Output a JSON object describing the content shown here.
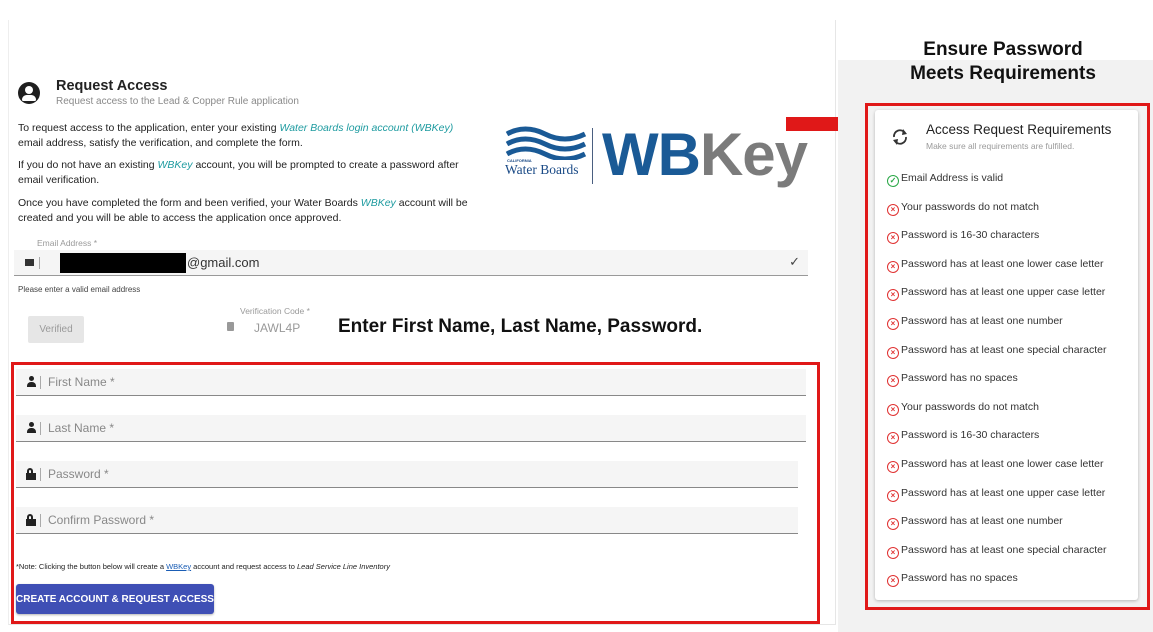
{
  "header": {
    "title": "Request Access",
    "subtitle": "Request access to the Lead & Copper Rule application"
  },
  "intro": {
    "p1_pre": "To request access to the application, enter your existing ",
    "p1_em": "Water Boards login account (WBKey)",
    "p1_post": " email address, satisfy the verification, and complete the form.",
    "p2_pre": "If you do not have an existing ",
    "p2_em": "WBKey",
    "p2_post": " account, you will be prompted to create a password after email verification.",
    "p3_pre": "Once you have completed the form and been verified, your Water Boards ",
    "p3_em": "WBKey",
    "p3_post": " account will be created and you will be able to access the application once approved."
  },
  "logo": {
    "org_tag": "CALIFORNIA",
    "org_name": "Water Boards",
    "wb": "WB",
    "key": "Key"
  },
  "email": {
    "label": "Email Address *",
    "domain": "@gmail.com",
    "help": "Please enter a valid email address",
    "check": "✓"
  },
  "verification": {
    "button": "Verified",
    "label": "Verification Code *",
    "value": "JAWL4P"
  },
  "annotations": {
    "middle": "Enter First Name, Last Name, Password.",
    "right_line1": "Ensure Password",
    "right_line2": "Meets Requirements"
  },
  "form": {
    "first_name": "First Name *",
    "last_name": "Last Name *",
    "password": "Password *",
    "confirm_password": "Confirm Password *",
    "note_pre": "*Note: Clicking the button below will create a ",
    "note_link": "WBKey",
    "note_mid": " account and request access to ",
    "note_em": "Lead Service Line Inventory",
    "submit": "CREATE ACCOUNT & REQUEST ACCESS"
  },
  "requirements": {
    "title": "Access Request Requirements",
    "subtitle": "Make sure all requirements are fulfilled.",
    "items": [
      {
        "text": "Email Address is valid",
        "ok": true
      },
      {
        "text": "Your passwords do not match",
        "ok": false
      },
      {
        "text": "Password is 16-30 characters",
        "ok": false
      },
      {
        "text": "Password has at least one lower case letter",
        "ok": false
      },
      {
        "text": "Password has at least one upper case letter",
        "ok": false
      },
      {
        "text": "Password has at least one number",
        "ok": false
      },
      {
        "text": "Password has at least one special character",
        "ok": false
      },
      {
        "text": "Password has no spaces",
        "ok": false
      },
      {
        "text": "Your passwords do not match",
        "ok": false
      },
      {
        "text": "Password is 16-30 characters",
        "ok": false
      },
      {
        "text": "Password has at least one lower case letter",
        "ok": false
      },
      {
        "text": "Password has at least one upper case letter",
        "ok": false
      },
      {
        "text": "Password has at least one number",
        "ok": false
      },
      {
        "text": "Password has at least one special character",
        "ok": false
      },
      {
        "text": "Password has no spaces",
        "ok": false
      }
    ]
  },
  "colors": {
    "accent": "#3f4fb5",
    "highlight": "#e01818",
    "ok": "#28a745",
    "error": "#e03030",
    "link": "#1e9ba0"
  }
}
